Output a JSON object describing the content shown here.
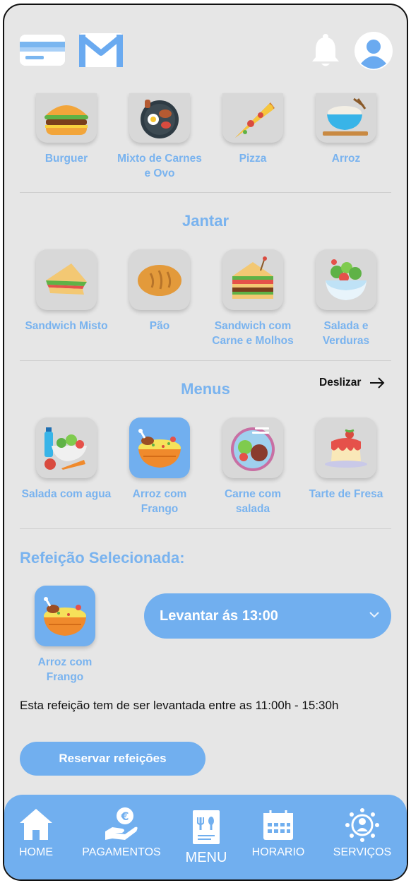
{
  "top_row": [
    {
      "label": "Burguer",
      "icon": "burger-icon"
    },
    {
      "label": "Mixto de Carnes e Ovo",
      "icon": "mixed-grill-icon"
    },
    {
      "label": "Pizza",
      "icon": "pizza-icon"
    },
    {
      "label": "Arroz",
      "icon": "rice-bowl-icon"
    }
  ],
  "jantar": {
    "title": "Jantar",
    "items": [
      {
        "label": "Sandwich Misto",
        "icon": "sandwich-icon"
      },
      {
        "label": "Pão",
        "icon": "bread-icon"
      },
      {
        "label": "Sandwich com Carne e Molhos",
        "icon": "club-sandwich-icon"
      },
      {
        "label": "Salada e Verduras",
        "icon": "salad-icon"
      }
    ]
  },
  "menus": {
    "title": "Menus",
    "scroll_hint": "Deslizar",
    "items": [
      {
        "label": "Salada com agua",
        "icon": "salad-water-icon"
      },
      {
        "label": "Arroz com Frango",
        "icon": "chicken-rice-icon",
        "selected": true
      },
      {
        "label": "Carne com salada",
        "icon": "meat-salad-icon"
      },
      {
        "label": "Tarte de Fresa",
        "icon": "strawberry-tart-icon"
      }
    ]
  },
  "selected_meal": {
    "title": "Refeição Selecionada:",
    "label": "Arroz com Frango",
    "pickup_select": "Levantar ás 13:00",
    "info_text": "Esta refeição tem de ser levantada entre as 11:00h - 15:30h",
    "reserve_button": "Reservar refeições"
  },
  "nav": [
    {
      "label": "HOME",
      "icon": "home-icon"
    },
    {
      "label": "PAGAMENTOS",
      "icon": "payment-icon"
    },
    {
      "label": "MENU",
      "icon": "menu-icon"
    },
    {
      "label": "HORARIO",
      "icon": "calendar-icon"
    },
    {
      "label": "SERVIÇOS",
      "icon": "services-icon"
    }
  ],
  "colors": {
    "accent": "#71afef",
    "text_accent": "#79b3ef",
    "background": "#e6e6e6"
  }
}
